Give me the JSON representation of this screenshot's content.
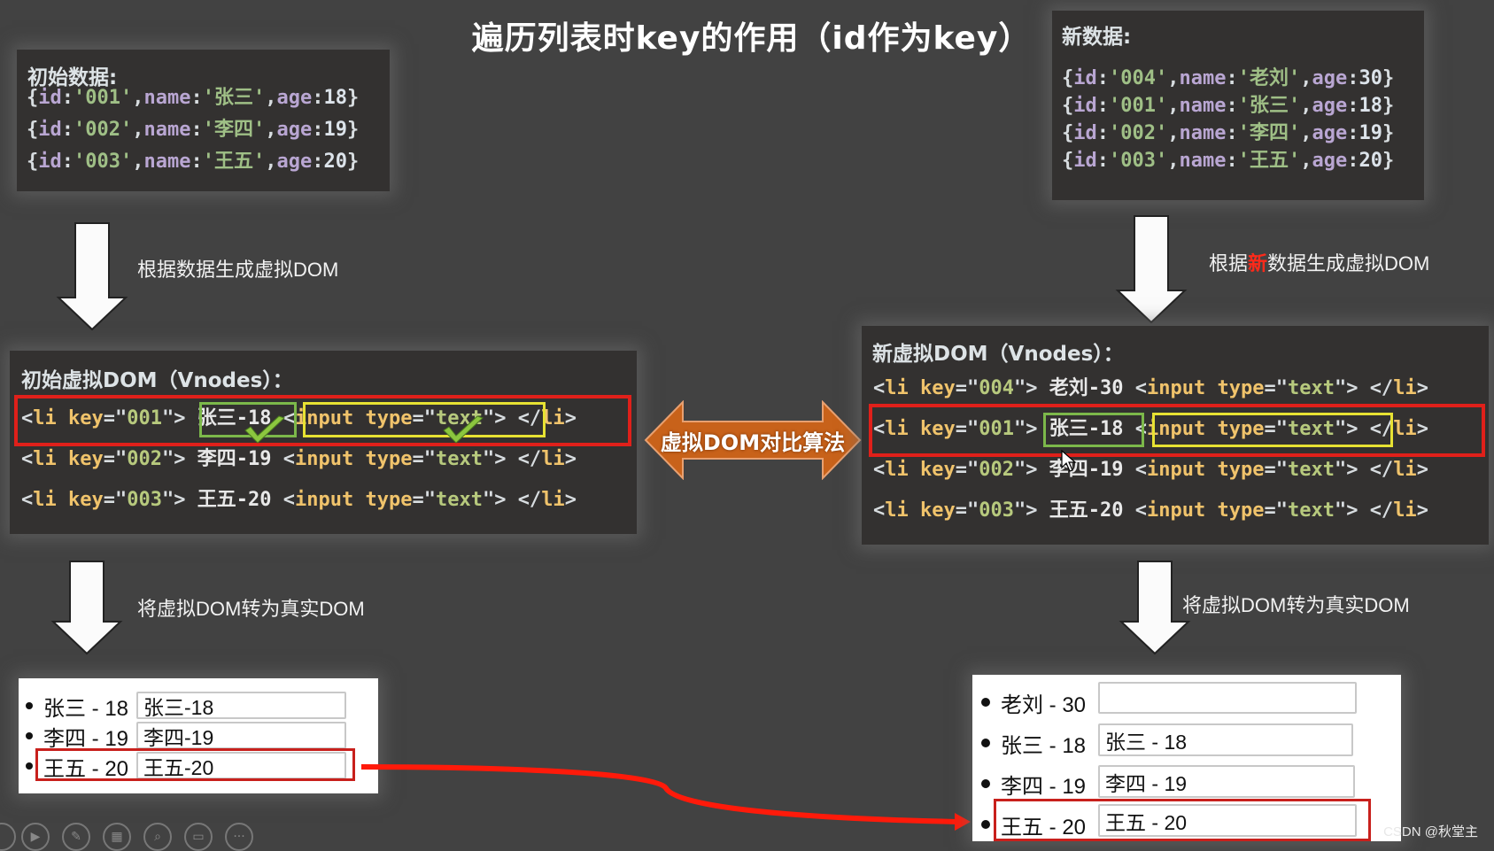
{
  "title": "遍历列表时key的作用（id作为key）",
  "initial_data": {
    "label": "初始数据:",
    "records": [
      {
        "id": "001",
        "name": "张三",
        "age": "18"
      },
      {
        "id": "002",
        "name": "李四",
        "age": "19"
      },
      {
        "id": "003",
        "name": "王五",
        "age": "20"
      }
    ]
  },
  "new_data": {
    "label": "新数据:",
    "records": [
      {
        "id": "004",
        "name": "老刘",
        "age": "30"
      },
      {
        "id": "001",
        "name": "张三",
        "age": "18"
      },
      {
        "id": "002",
        "name": "李四",
        "age": "19"
      },
      {
        "id": "003",
        "name": "王五",
        "age": "20"
      }
    ]
  },
  "steps": {
    "left_generate": "根据数据生成虚拟DOM",
    "right_generate_prefix": "根据",
    "right_generate_highlight": "新",
    "right_generate_suffix": "数据生成虚拟DOM",
    "left_render": "将虚拟DOM转为真实DOM",
    "right_render": "将虚拟DOM转为真实DOM",
    "diff_algorithm": "虚拟DOM对比算法"
  },
  "initial_vdom": {
    "label": "初始虚拟DOM（Vnodes）：",
    "rows": [
      {
        "key": "001",
        "text": "张三-18"
      },
      {
        "key": "002",
        "text": "李四-19"
      },
      {
        "key": "003",
        "text": "王五-20"
      }
    ]
  },
  "new_vdom": {
    "label": "新虚拟DOM（Vnodes）：",
    "rows": [
      {
        "key": "004",
        "text": "老刘-30"
      },
      {
        "key": "001",
        "text": "张三-18"
      },
      {
        "key": "002",
        "text": "李四-19"
      },
      {
        "key": "003",
        "text": "王五-20"
      }
    ]
  },
  "code_tokens": {
    "li_open": "<li",
    "key_attr": " key",
    "eq": "=",
    "quote": "\"",
    "gt": ">",
    "input_open": "<input",
    "type_attr": " type",
    "text_value": "text",
    "li_close_lt": "</",
    "li_close_name": "li",
    "id_key": "id",
    "name_key": "name",
    "age_key": "age",
    "colon": ":",
    "comma": ",",
    "squote": "'",
    "lbrace": "{",
    "rbrace": "}"
  },
  "initial_real_dom": {
    "items": [
      {
        "label": "张三 - 18",
        "input_value": "张三-18"
      },
      {
        "label": "李四 - 19",
        "input_value": "李四-19"
      },
      {
        "label": "王五 - 20",
        "input_value": "王五-20"
      }
    ]
  },
  "new_real_dom": {
    "items": [
      {
        "label": "老刘 - 30",
        "input_value": ""
      },
      {
        "label": "张三 - 18",
        "input_value": "张三 - 18"
      },
      {
        "label": "李四 - 19",
        "input_value": "李四 - 19"
      },
      {
        "label": "王五 - 20",
        "input_value": "王五 - 20"
      }
    ]
  },
  "toolbar": {
    "icons": [
      "prev-icon",
      "play-icon",
      "pen-icon",
      "slides-icon",
      "zoom-icon",
      "subtitle-icon",
      "more-icon"
    ]
  },
  "watermark": "CSDN @秋堂主",
  "colors": {
    "background": "#424242",
    "panel": "#333130",
    "highlight_red": "#e0201a",
    "highlight_green": "#7cb84a",
    "highlight_yellow": "#e7e233",
    "diff_arrow": "#c8621a",
    "check": "#8cc63f"
  }
}
